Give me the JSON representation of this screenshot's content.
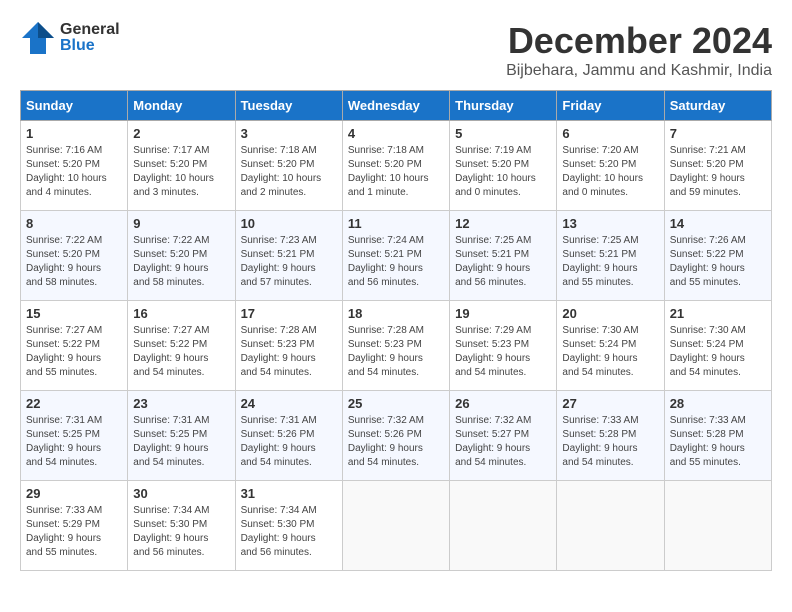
{
  "header": {
    "logo_general": "General",
    "logo_blue": "Blue",
    "month_title": "December 2024",
    "subtitle": "Bijbehara, Jammu and Kashmir, India"
  },
  "weekdays": [
    "Sunday",
    "Monday",
    "Tuesday",
    "Wednesday",
    "Thursday",
    "Friday",
    "Saturday"
  ],
  "weeks": [
    [
      {
        "day": "1",
        "info": "Sunrise: 7:16 AM\nSunset: 5:20 PM\nDaylight: 10 hours\nand 4 minutes."
      },
      {
        "day": "2",
        "info": "Sunrise: 7:17 AM\nSunset: 5:20 PM\nDaylight: 10 hours\nand 3 minutes."
      },
      {
        "day": "3",
        "info": "Sunrise: 7:18 AM\nSunset: 5:20 PM\nDaylight: 10 hours\nand 2 minutes."
      },
      {
        "day": "4",
        "info": "Sunrise: 7:18 AM\nSunset: 5:20 PM\nDaylight: 10 hours\nand 1 minute."
      },
      {
        "day": "5",
        "info": "Sunrise: 7:19 AM\nSunset: 5:20 PM\nDaylight: 10 hours\nand 0 minutes."
      },
      {
        "day": "6",
        "info": "Sunrise: 7:20 AM\nSunset: 5:20 PM\nDaylight: 10 hours\nand 0 minutes."
      },
      {
        "day": "7",
        "info": "Sunrise: 7:21 AM\nSunset: 5:20 PM\nDaylight: 9 hours\nand 59 minutes."
      }
    ],
    [
      {
        "day": "8",
        "info": "Sunrise: 7:22 AM\nSunset: 5:20 PM\nDaylight: 9 hours\nand 58 minutes."
      },
      {
        "day": "9",
        "info": "Sunrise: 7:22 AM\nSunset: 5:20 PM\nDaylight: 9 hours\nand 58 minutes."
      },
      {
        "day": "10",
        "info": "Sunrise: 7:23 AM\nSunset: 5:21 PM\nDaylight: 9 hours\nand 57 minutes."
      },
      {
        "day": "11",
        "info": "Sunrise: 7:24 AM\nSunset: 5:21 PM\nDaylight: 9 hours\nand 56 minutes."
      },
      {
        "day": "12",
        "info": "Sunrise: 7:25 AM\nSunset: 5:21 PM\nDaylight: 9 hours\nand 56 minutes."
      },
      {
        "day": "13",
        "info": "Sunrise: 7:25 AM\nSunset: 5:21 PM\nDaylight: 9 hours\nand 55 minutes."
      },
      {
        "day": "14",
        "info": "Sunrise: 7:26 AM\nSunset: 5:22 PM\nDaylight: 9 hours\nand 55 minutes."
      }
    ],
    [
      {
        "day": "15",
        "info": "Sunrise: 7:27 AM\nSunset: 5:22 PM\nDaylight: 9 hours\nand 55 minutes."
      },
      {
        "day": "16",
        "info": "Sunrise: 7:27 AM\nSunset: 5:22 PM\nDaylight: 9 hours\nand 54 minutes."
      },
      {
        "day": "17",
        "info": "Sunrise: 7:28 AM\nSunset: 5:23 PM\nDaylight: 9 hours\nand 54 minutes."
      },
      {
        "day": "18",
        "info": "Sunrise: 7:28 AM\nSunset: 5:23 PM\nDaylight: 9 hours\nand 54 minutes."
      },
      {
        "day": "19",
        "info": "Sunrise: 7:29 AM\nSunset: 5:23 PM\nDaylight: 9 hours\nand 54 minutes."
      },
      {
        "day": "20",
        "info": "Sunrise: 7:30 AM\nSunset: 5:24 PM\nDaylight: 9 hours\nand 54 minutes."
      },
      {
        "day": "21",
        "info": "Sunrise: 7:30 AM\nSunset: 5:24 PM\nDaylight: 9 hours\nand 54 minutes."
      }
    ],
    [
      {
        "day": "22",
        "info": "Sunrise: 7:31 AM\nSunset: 5:25 PM\nDaylight: 9 hours\nand 54 minutes."
      },
      {
        "day": "23",
        "info": "Sunrise: 7:31 AM\nSunset: 5:25 PM\nDaylight: 9 hours\nand 54 minutes."
      },
      {
        "day": "24",
        "info": "Sunrise: 7:31 AM\nSunset: 5:26 PM\nDaylight: 9 hours\nand 54 minutes."
      },
      {
        "day": "25",
        "info": "Sunrise: 7:32 AM\nSunset: 5:26 PM\nDaylight: 9 hours\nand 54 minutes."
      },
      {
        "day": "26",
        "info": "Sunrise: 7:32 AM\nSunset: 5:27 PM\nDaylight: 9 hours\nand 54 minutes."
      },
      {
        "day": "27",
        "info": "Sunrise: 7:33 AM\nSunset: 5:28 PM\nDaylight: 9 hours\nand 54 minutes."
      },
      {
        "day": "28",
        "info": "Sunrise: 7:33 AM\nSunset: 5:28 PM\nDaylight: 9 hours\nand 55 minutes."
      }
    ],
    [
      {
        "day": "29",
        "info": "Sunrise: 7:33 AM\nSunset: 5:29 PM\nDaylight: 9 hours\nand 55 minutes."
      },
      {
        "day": "30",
        "info": "Sunrise: 7:34 AM\nSunset: 5:30 PM\nDaylight: 9 hours\nand 56 minutes."
      },
      {
        "day": "31",
        "info": "Sunrise: 7:34 AM\nSunset: 5:30 PM\nDaylight: 9 hours\nand 56 minutes."
      },
      {
        "day": "",
        "info": ""
      },
      {
        "day": "",
        "info": ""
      },
      {
        "day": "",
        "info": ""
      },
      {
        "day": "",
        "info": ""
      }
    ]
  ]
}
